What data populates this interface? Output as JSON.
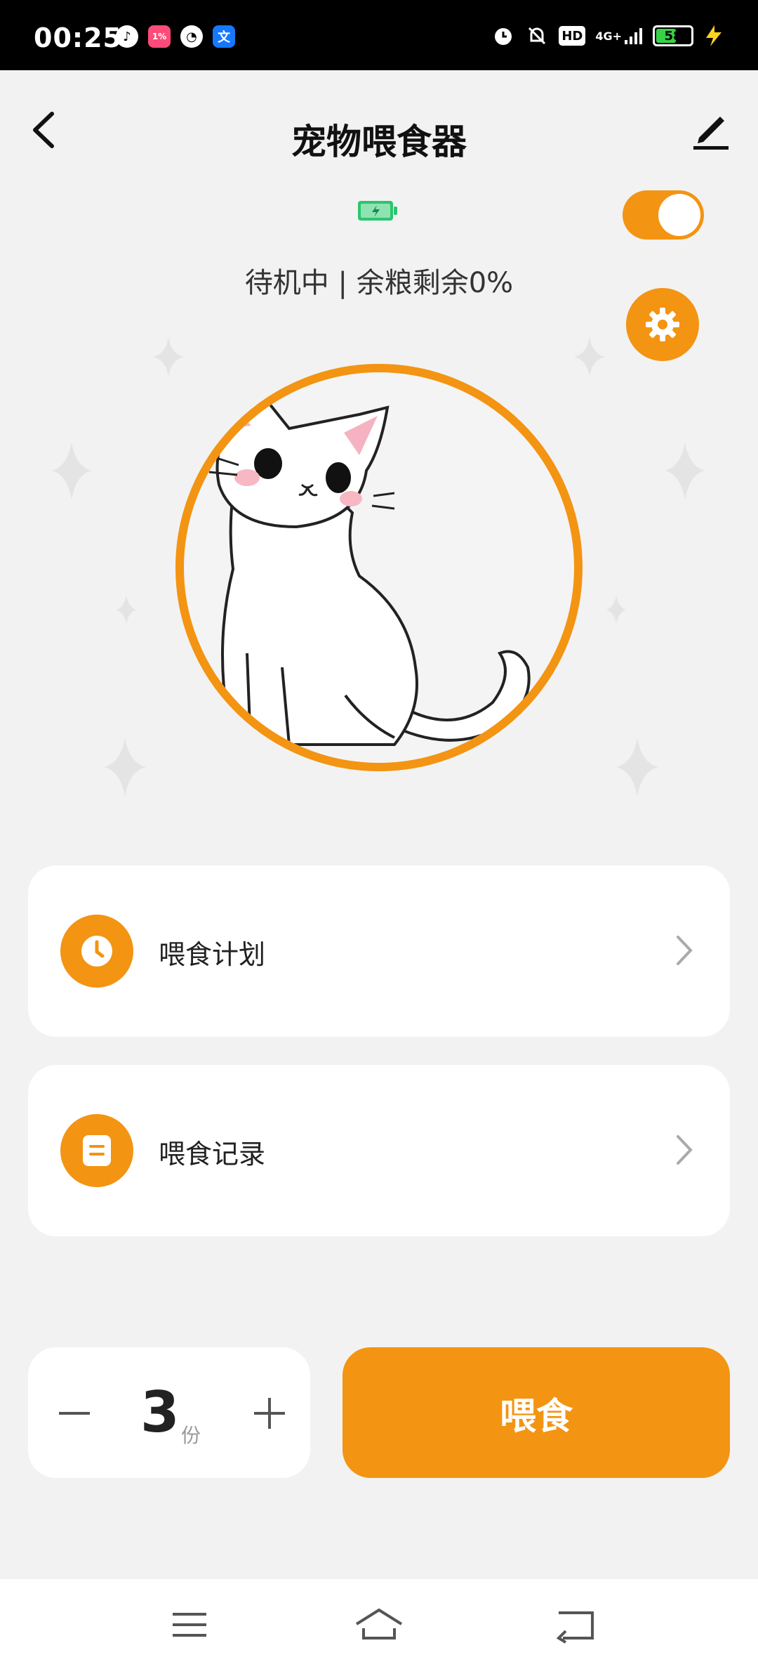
{
  "status_bar": {
    "time": "00:25",
    "apps": [
      {
        "icon": "music-app-icon",
        "color": "#000000"
      },
      {
        "icon": "news-app-icon",
        "color": "#ff4b7a",
        "text": "1%"
      },
      {
        "icon": "speed-app-icon",
        "color": "#000000"
      },
      {
        "icon": "translate-app-icon",
        "color": "#1677ff",
        "text": "文"
      }
    ],
    "network": "4G+",
    "hd": "HD",
    "battery": "58"
  },
  "header": {
    "title": "宠物喂食器"
  },
  "device": {
    "status": "待机中 | 余粮剩余0%",
    "power_on": true
  },
  "menu": [
    {
      "label": "喂食计划",
      "icon": "clock-icon"
    },
    {
      "label": "喂食记录",
      "icon": "document-icon"
    }
  ],
  "quantity": {
    "value": "3",
    "unit": "份"
  },
  "feed_button": "喂食",
  "colors": {
    "accent": "#f39412",
    "background": "#f2f2f2"
  }
}
